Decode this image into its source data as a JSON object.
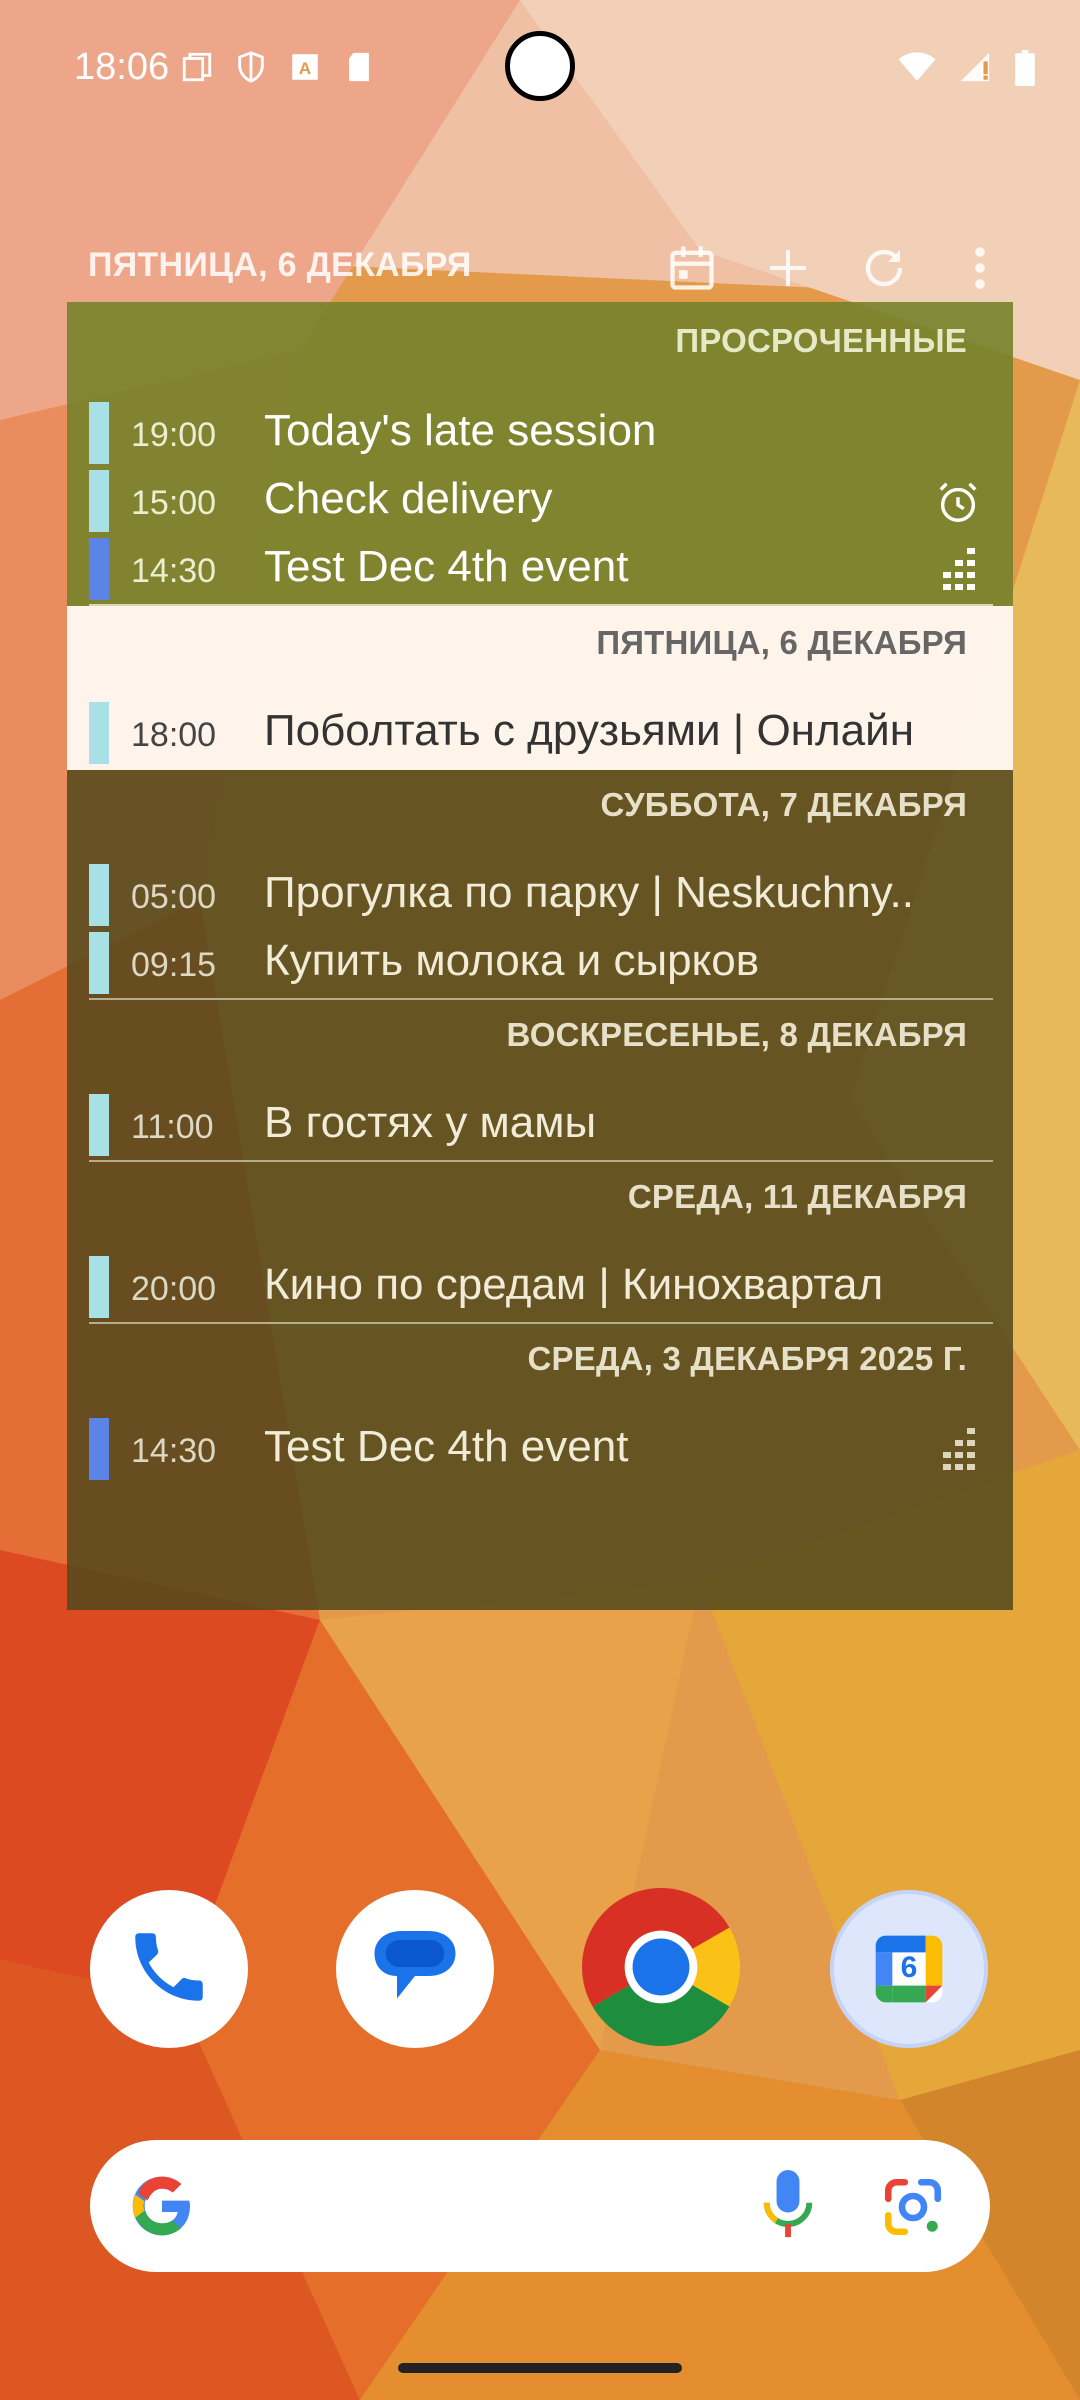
{
  "status_bar": {
    "time": "18:06",
    "left_icons": [
      "copy-icon",
      "shield-icon",
      "font-icon",
      "sd-card-icon"
    ],
    "right_icons": [
      "wifi-icon",
      "signal-icon",
      "battery-icon"
    ]
  },
  "widget": {
    "header_date": "ПЯТНИЦА, 6 ДЕКАБРЯ",
    "actions": [
      "calendar-icon",
      "plus-icon",
      "refresh-icon",
      "more-vert-icon"
    ],
    "sections": [
      {
        "header": "ПРОСРОЧЕННЫЕ",
        "events": [
          {
            "time": "19:00",
            "title": "Today's late session",
            "color": "#a7e1e6",
            "icon": ""
          },
          {
            "time": "15:00",
            "title": "Check delivery",
            "color": "#a7e1e6",
            "icon": "alarm-icon"
          },
          {
            "time": "14:30",
            "title": "Test Dec 4th event",
            "color": "#5b84e6",
            "icon": "dots-grid-icon"
          }
        ]
      },
      {
        "header": "ПЯТНИЦА, 6 ДЕКАБРЯ",
        "events": [
          {
            "time": "18:00",
            "title": "Поболтать с друзьями  |  Онлайн",
            "color": "#a7e1e6",
            "icon": ""
          }
        ]
      },
      {
        "header": "СУББОТА, 7 ДЕКАБРЯ",
        "events": [
          {
            "time": "05:00",
            "title": "Прогулка по парку  |  Neskuchny..",
            "color": "#a7e1e6",
            "icon": ""
          },
          {
            "time": "09:15",
            "title": "Купить молока  и сырков",
            "color": "#a7e1e6",
            "icon": ""
          }
        ]
      },
      {
        "header": "ВОСКРЕСЕНЬЕ, 8 ДЕКАБРЯ",
        "events": [
          {
            "time": "11:00",
            "title": "В гостях у мамы",
            "color": "#a7e1e6",
            "icon": ""
          }
        ]
      },
      {
        "header": "СРЕДА, 11 ДЕКАБРЯ",
        "events": [
          {
            "time": "20:00",
            "title": "Кино по средам  |  Кинохвартал",
            "color": "#a7e1e6",
            "icon": ""
          }
        ]
      },
      {
        "header": "СРЕДА, 3 ДЕКАБРЯ 2025 Г.",
        "events": [
          {
            "time": "14:30",
            "title": "Test Dec 4th event",
            "color": "#5b84e6",
            "icon": "dots-grid-icon"
          }
        ]
      }
    ]
  },
  "dock": {
    "apps": [
      "phone-icon",
      "messages-icon",
      "chrome-icon",
      "calendar-app-icon"
    ],
    "calendar_day": "6"
  },
  "search_bar": {
    "icons": [
      "google-g-icon",
      "mic-icon",
      "lens-icon"
    ]
  }
}
